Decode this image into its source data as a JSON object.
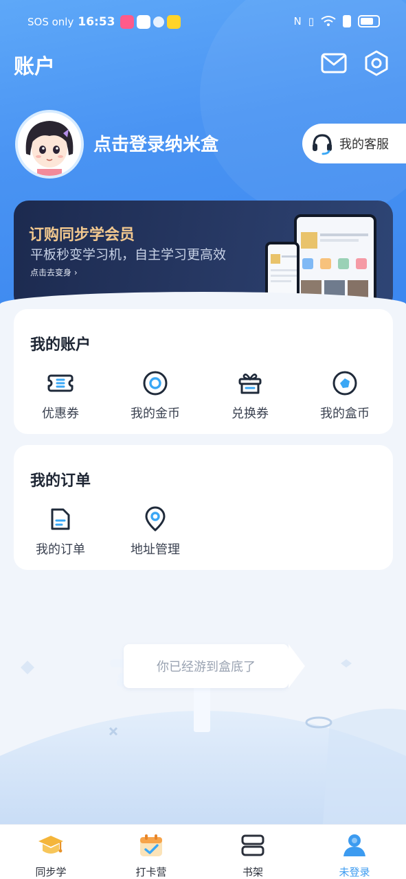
{
  "status_bar": {
    "carrier": "SOS only",
    "time": "16:53"
  },
  "header": {
    "title": "账户",
    "mail_icon": "mail-icon",
    "settings_icon": "settings-icon"
  },
  "profile": {
    "login_text": "点击登录纳米盒",
    "service_label": "我的客服"
  },
  "vip_banner": {
    "title": "订购同步学会员",
    "subtitle": "平板秒变学习机，自主学习更高效",
    "link": "点击去变身 ›"
  },
  "account_card": {
    "title": "我的账户",
    "items": [
      {
        "label": "优惠券",
        "icon": "coupon-icon"
      },
      {
        "label": "我的金币",
        "icon": "gold-coin-icon"
      },
      {
        "label": "兑换券",
        "icon": "gift-box-icon"
      },
      {
        "label": "我的盒币",
        "icon": "box-coin-icon"
      }
    ]
  },
  "orders_card": {
    "title": "我的订单",
    "items": [
      {
        "label": "我的订单",
        "icon": "order-document-icon"
      },
      {
        "label": "地址管理",
        "icon": "location-pin-icon"
      }
    ]
  },
  "footer_text": "你已经游到盒底了",
  "tabbar": {
    "tabs": [
      {
        "label": "同步学",
        "icon": "graduation-cap-icon"
      },
      {
        "label": "打卡营",
        "icon": "calendar-check-icon"
      },
      {
        "label": "书架",
        "icon": "bookshelf-icon"
      },
      {
        "label": "未登录",
        "icon": "user-icon",
        "active": true
      }
    ]
  },
  "colors": {
    "header_blue": "#4a94f3",
    "active_tab": "#3c9bf0",
    "vip_gold": "#f3c98f"
  }
}
